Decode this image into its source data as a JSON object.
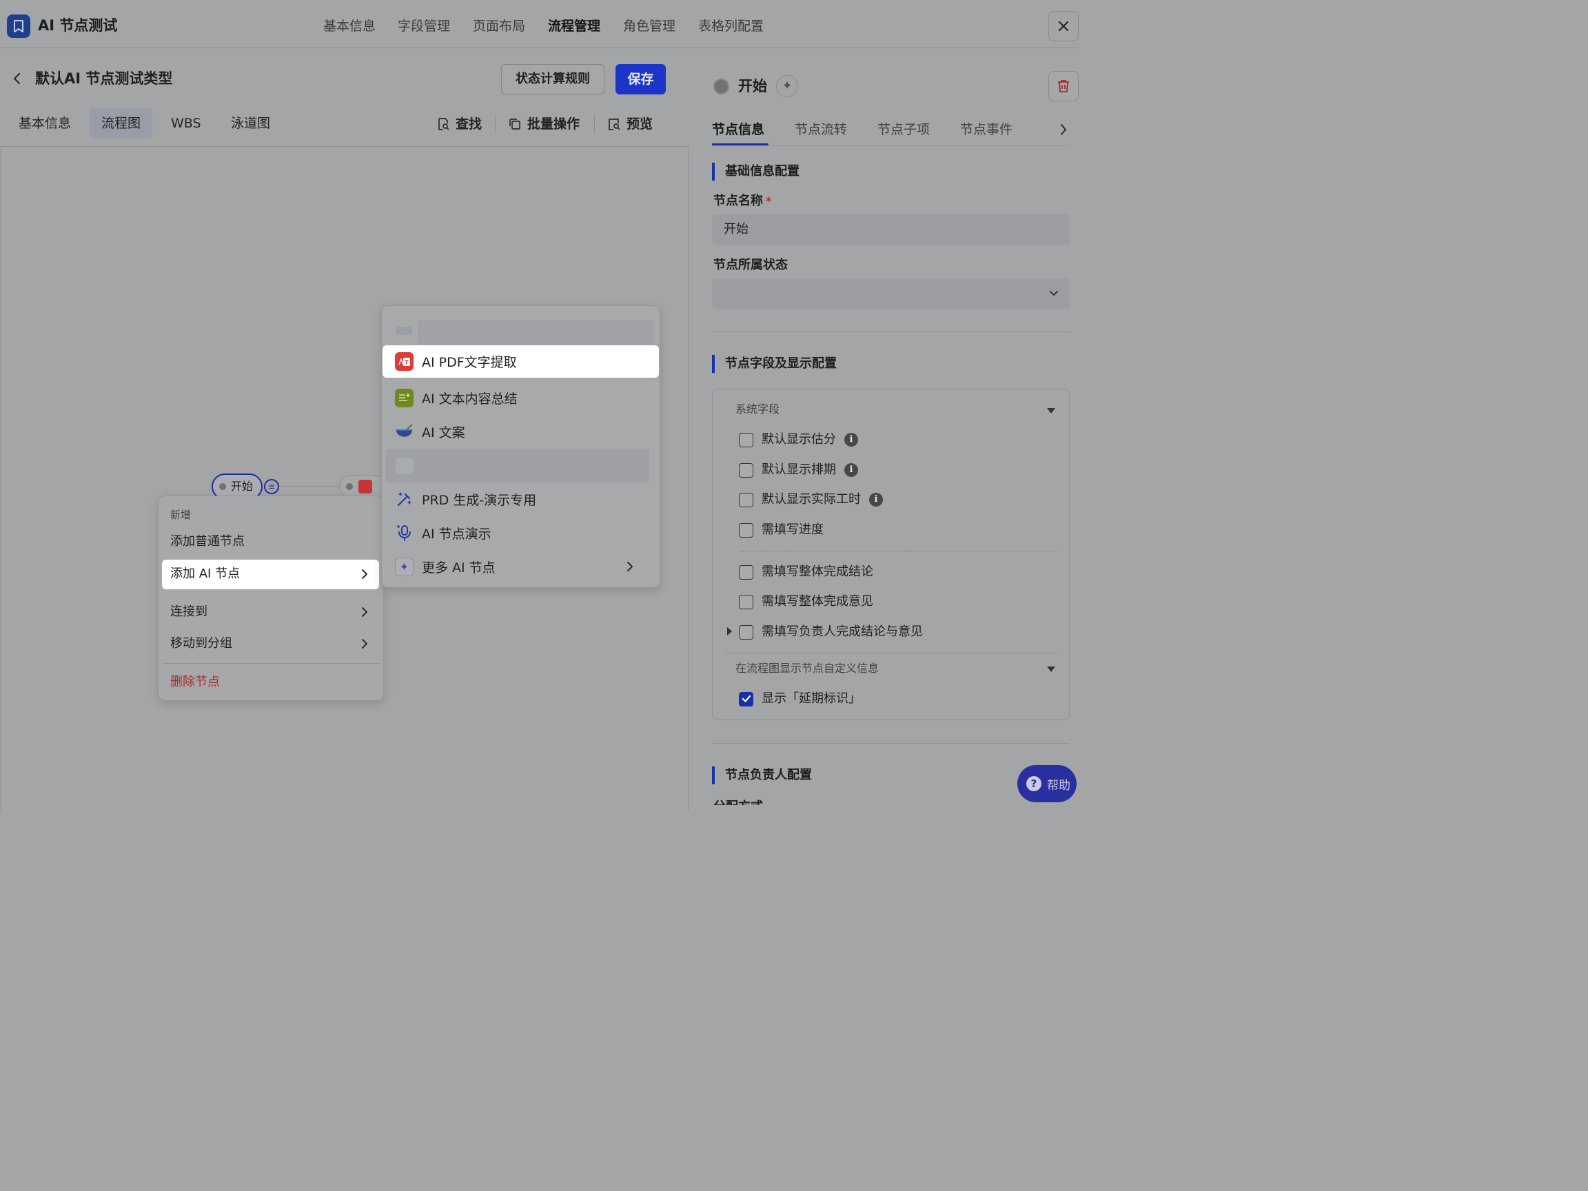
{
  "app": {
    "title": "AI 节点测试",
    "close_label": "✕"
  },
  "top_tabs": [
    "基本信息",
    "字段管理",
    "页面布局",
    "流程管理",
    "角色管理",
    "表格列配置"
  ],
  "header": {
    "title": "默认AI 节点测试类型",
    "rule_button": "状态计算规则",
    "save_button": "保存"
  },
  "sub_tabs": [
    "基本信息",
    "流程图",
    "WBS",
    "泳道图"
  ],
  "tools": {
    "find": "查找",
    "batch": "批量操作",
    "preview": "预览"
  },
  "canvas": {
    "start_node": "开始"
  },
  "context_menu": {
    "group_label": "新增",
    "add_normal": "添加普通节点",
    "add_ai": "添加 AI 节点",
    "connect": "连接到",
    "move_group": "移动到分组",
    "delete": "删除节点"
  },
  "submenu": {
    "items": [
      "AI PDF文字提取",
      "AI 文本内容总结",
      "AI 文案",
      "PRD 生成-演示专用",
      "AI 节点演示",
      "更多 AI 节点"
    ]
  },
  "right_panel": {
    "node_title": "开始",
    "tabs": [
      "节点信息",
      "节点流转",
      "节点子项",
      "节点事件"
    ],
    "section_basic": "基础信息配置",
    "name_label": "节点名称",
    "required_mark": "*",
    "name_value": "开始",
    "status_label": "节点所属状态",
    "section_fields": "节点字段及显示配置",
    "system_fields_label": "系统字段",
    "checkboxes": [
      "默认显示估分",
      "默认显示排期",
      "默认显示实际工时",
      "需填写进度",
      "需填写整体完成结论",
      "需填写整体完成意见",
      "需填写负责人完成结论与意见"
    ],
    "custom_info_label": "在流程图显示节点自定义信息",
    "delay_label": "显示「延期标识」",
    "section_owner": "节点负责人配置",
    "cutoff_text": "分配方式"
  },
  "help": {
    "label": "帮助"
  },
  "colors": {
    "accent": "#1b2fa8",
    "save_bg": "#1a35c8",
    "danger": "#a52a2a",
    "overlay": "#a4a5a7"
  }
}
